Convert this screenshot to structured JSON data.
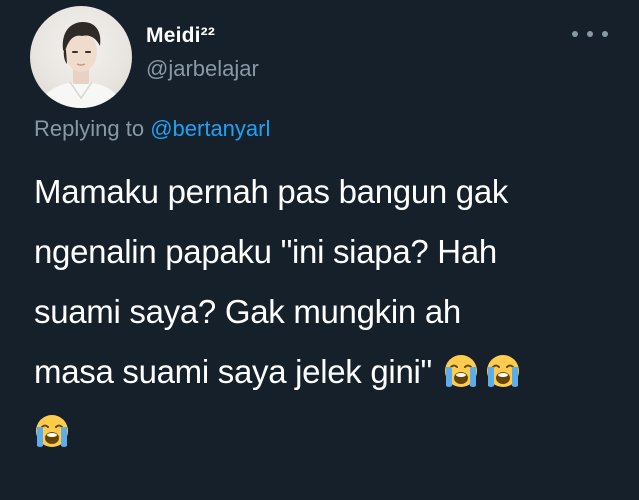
{
  "user": {
    "display_name": "Meidi²²",
    "handle": "@jarbelajar"
  },
  "reply": {
    "prefix": "Replying to",
    "mention": "@bertanyarl"
  },
  "tweet": {
    "lines": [
      "Mamaku pernah pas bangun gak",
      "ngenalin papaku \"ini siapa? Hah",
      "suami saya? Gak mungkin ah",
      "masa suami saya jelek gini\""
    ],
    "emoji_name": "loudly-crying-face"
  },
  "icons": {
    "more": "more-options-icon",
    "avatar": "profile-photo"
  },
  "colors": {
    "background": "#15202b",
    "primary_text": "#ffffff",
    "secondary_text": "#8899a6",
    "link": "#1da1f2"
  }
}
